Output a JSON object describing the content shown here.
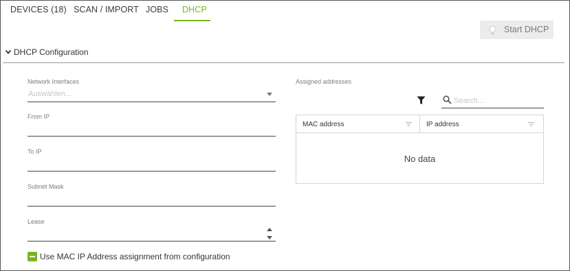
{
  "tabs": [
    {
      "label": "DEVICES (18)",
      "active": false
    },
    {
      "label": "SCAN / IMPORT",
      "active": false
    },
    {
      "label": "JOBS",
      "active": false
    },
    {
      "label": "DHCP",
      "active": true
    }
  ],
  "colors": {
    "accent": "#7ab51d",
    "button_bg": "#ececec",
    "border": "#d4d4d4"
  },
  "toolbar": {
    "start_dhcp_label": "Start DHCP",
    "start_dhcp_icon": "lightbulb-icon"
  },
  "section": {
    "title": "DHCP Configuration",
    "expanded": true
  },
  "form": {
    "network_interfaces": {
      "label": "Network Interfaces",
      "placeholder": "Auswählen..."
    },
    "from_ip": {
      "label": "From IP",
      "value": ""
    },
    "to_ip": {
      "label": "To IP",
      "value": ""
    },
    "subnet_mask": {
      "label": "Subnet Mask",
      "value": ""
    },
    "lease": {
      "label": "Lease",
      "value": ""
    },
    "use_mac": {
      "label": "Use MAC IP Address assignment from configuration",
      "checked": "indeterminate"
    }
  },
  "assigned": {
    "label": "Assigned addresses",
    "search_placeholder": "Search...",
    "columns": [
      "MAC address",
      "IP address"
    ],
    "empty_text": "No data"
  }
}
